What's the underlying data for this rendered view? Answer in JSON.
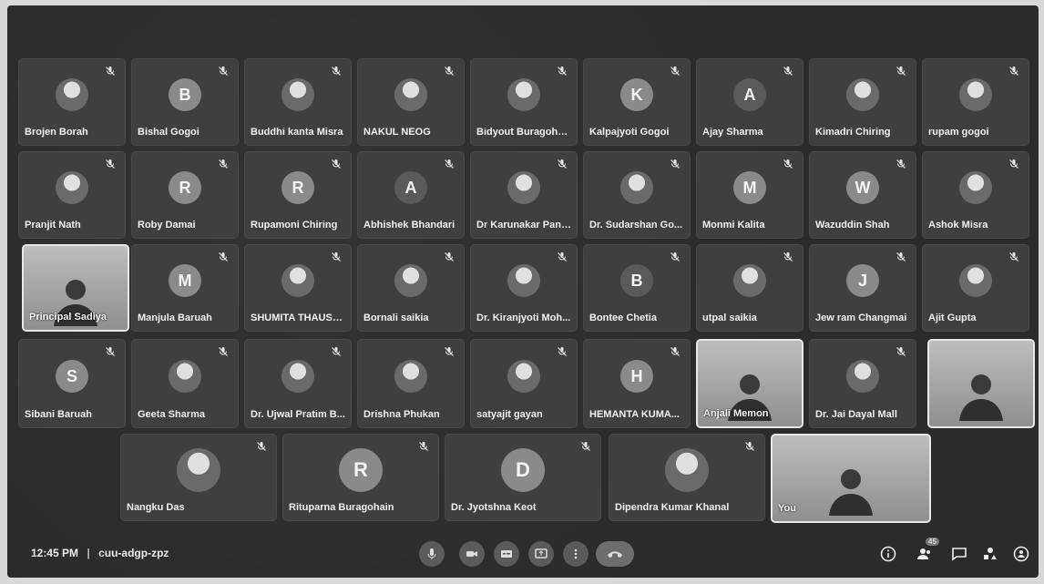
{
  "participants_grid": [
    {
      "name": "Brojen Borah",
      "avatar": "photo"
    },
    {
      "name": "Bishal Gogoi",
      "avatar": "letter",
      "initial": "B"
    },
    {
      "name": "Buddhi kanta Misra",
      "avatar": "photo"
    },
    {
      "name": "NAKUL NEOG",
      "avatar": "photo"
    },
    {
      "name": "Bidyout Buragohain",
      "avatar": "photo"
    },
    {
      "name": "Kalpajyoti Gogoi",
      "avatar": "letter",
      "initial": "K"
    },
    {
      "name": "Ajay Sharma",
      "avatar": "plain",
      "initial": "A"
    },
    {
      "name": "Kimadri Chiring",
      "avatar": "photo"
    },
    {
      "name": "rupam gogoi",
      "avatar": "photo"
    },
    {
      "name": "Pranjit Nath",
      "avatar": "photo"
    },
    {
      "name": "Roby Damai",
      "avatar": "letter",
      "initial": "R"
    },
    {
      "name": "Rupamoni Chiring",
      "avatar": "letter",
      "initial": "R"
    },
    {
      "name": "Abhishek Bhandari",
      "avatar": "plain",
      "initial": "A"
    },
    {
      "name": "Dr Karunakar Panda",
      "avatar": "photo"
    },
    {
      "name": "Dr. Sudarshan Go...",
      "avatar": "photo"
    },
    {
      "name": "Monmi Kalita",
      "avatar": "letter",
      "initial": "M"
    },
    {
      "name": "Wazuddin Shah",
      "avatar": "letter",
      "initial": "W"
    },
    {
      "name": "Ashok Misra",
      "avatar": "photo"
    },
    {
      "name": "Principal Sadiya",
      "avatar": "video"
    },
    {
      "name": "Manjula Baruah",
      "avatar": "letter",
      "initial": "M"
    },
    {
      "name": "SHUMITA THAUSEN",
      "avatar": "photo"
    },
    {
      "name": "Bornali saikia",
      "avatar": "photo"
    },
    {
      "name": "Dr. Kiranjyoti Moh...",
      "avatar": "photo"
    },
    {
      "name": "Bontee Chetia",
      "avatar": "plain",
      "initial": "B"
    },
    {
      "name": "utpal saikia",
      "avatar": "photo"
    },
    {
      "name": "Jew ram Changmai",
      "avatar": "letter",
      "initial": "J"
    },
    {
      "name": "Ajit Gupta",
      "avatar": "photo"
    },
    {
      "name": "Sibani Baruah",
      "avatar": "letter",
      "initial": "S"
    },
    {
      "name": "Geeta Sharma",
      "avatar": "photo"
    },
    {
      "name": "Dr. Ujwal Pratim B...",
      "avatar": "photo"
    },
    {
      "name": "Drishna Phukan",
      "avatar": "photo"
    },
    {
      "name": "satyajit gayan",
      "avatar": "photo"
    },
    {
      "name": "HEMANTA KUMA...",
      "avatar": "letter",
      "initial": "H"
    },
    {
      "name": "Anjali Memon",
      "avatar": "video"
    },
    {
      "name": "Dr. Jai Dayal Mall",
      "avatar": "photo"
    },
    {
      "name": "",
      "avatar": "video"
    },
    {
      "name": "Nangku Das",
      "avatar": "photo"
    },
    {
      "name": "Rituparna Buragohain",
      "avatar": "letter",
      "initial": "R"
    },
    {
      "name": "Dr. Jyotshna Keot",
      "avatar": "letter",
      "initial": "D"
    },
    {
      "name": "Dipendra Kumar Khanal",
      "avatar": "photo"
    },
    {
      "name": "You",
      "avatar": "video"
    }
  ],
  "footer": {
    "time": "12:45 PM",
    "separator": "|",
    "meeting_code": "cuu-adgp-zpz",
    "people_count": "45"
  },
  "colors": {
    "stage_bg": "#2b2b2b",
    "tile_bg": "#3f3f3f",
    "avatar_bg": "#8a8a8a",
    "control_bg": "#5b5b5b"
  }
}
